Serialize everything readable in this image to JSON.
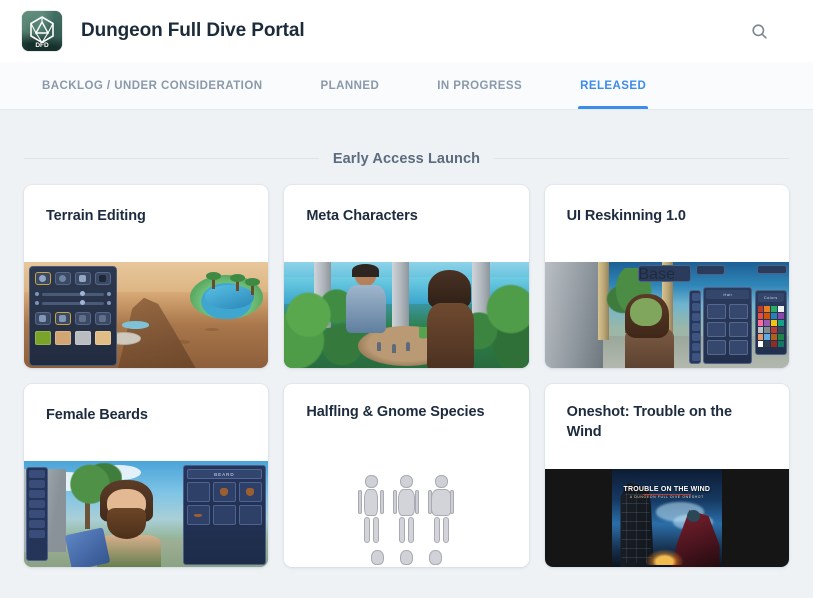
{
  "header": {
    "app_title": "Dungeon Full Dive Portal",
    "logo_text": "DFD",
    "logo_icon": "d20-die-icon",
    "search_icon": "search-icon"
  },
  "tabs": [
    {
      "label": "BACKLOG / UNDER CONSIDERATION",
      "active": false
    },
    {
      "label": "PLANNED",
      "active": false
    },
    {
      "label": "IN PROGRESS",
      "active": false
    },
    {
      "label": "RELEASED",
      "active": true
    }
  ],
  "section": {
    "title": "Early Access Launch"
  },
  "cards": [
    {
      "title": "Terrain Editing"
    },
    {
      "title": "Meta Characters"
    },
    {
      "title": "UI Reskinning 1.0"
    },
    {
      "title": "Female Beards"
    },
    {
      "title": "Halfling & Gnome Species"
    },
    {
      "title": "Oneshot: Trouble on the Wind"
    }
  ],
  "thumbnails": {
    "terrain_swatches": [
      "#7aa32a",
      "#d2a673",
      "#b9bcc0",
      "#e0bd85"
    ],
    "beard_panel_label": "BEARD",
    "ui_hair_label": "Hair",
    "ui_colors_label": "Colors",
    "ui_base_label": "Base",
    "poster_title": "TROUBLE ON THE WIND",
    "poster_subtitle": "A DUNGEON FULL DIVE ONESHOT"
  },
  "colors": {
    "accent": "#3c8ce9",
    "page_background": "#eef2f5",
    "header_background": "#ffffff",
    "tabbar_background": "#f9fbfc",
    "card_background": "#ffffff",
    "title_text": "#1d2b3e",
    "muted_text": "#8a99ab"
  }
}
